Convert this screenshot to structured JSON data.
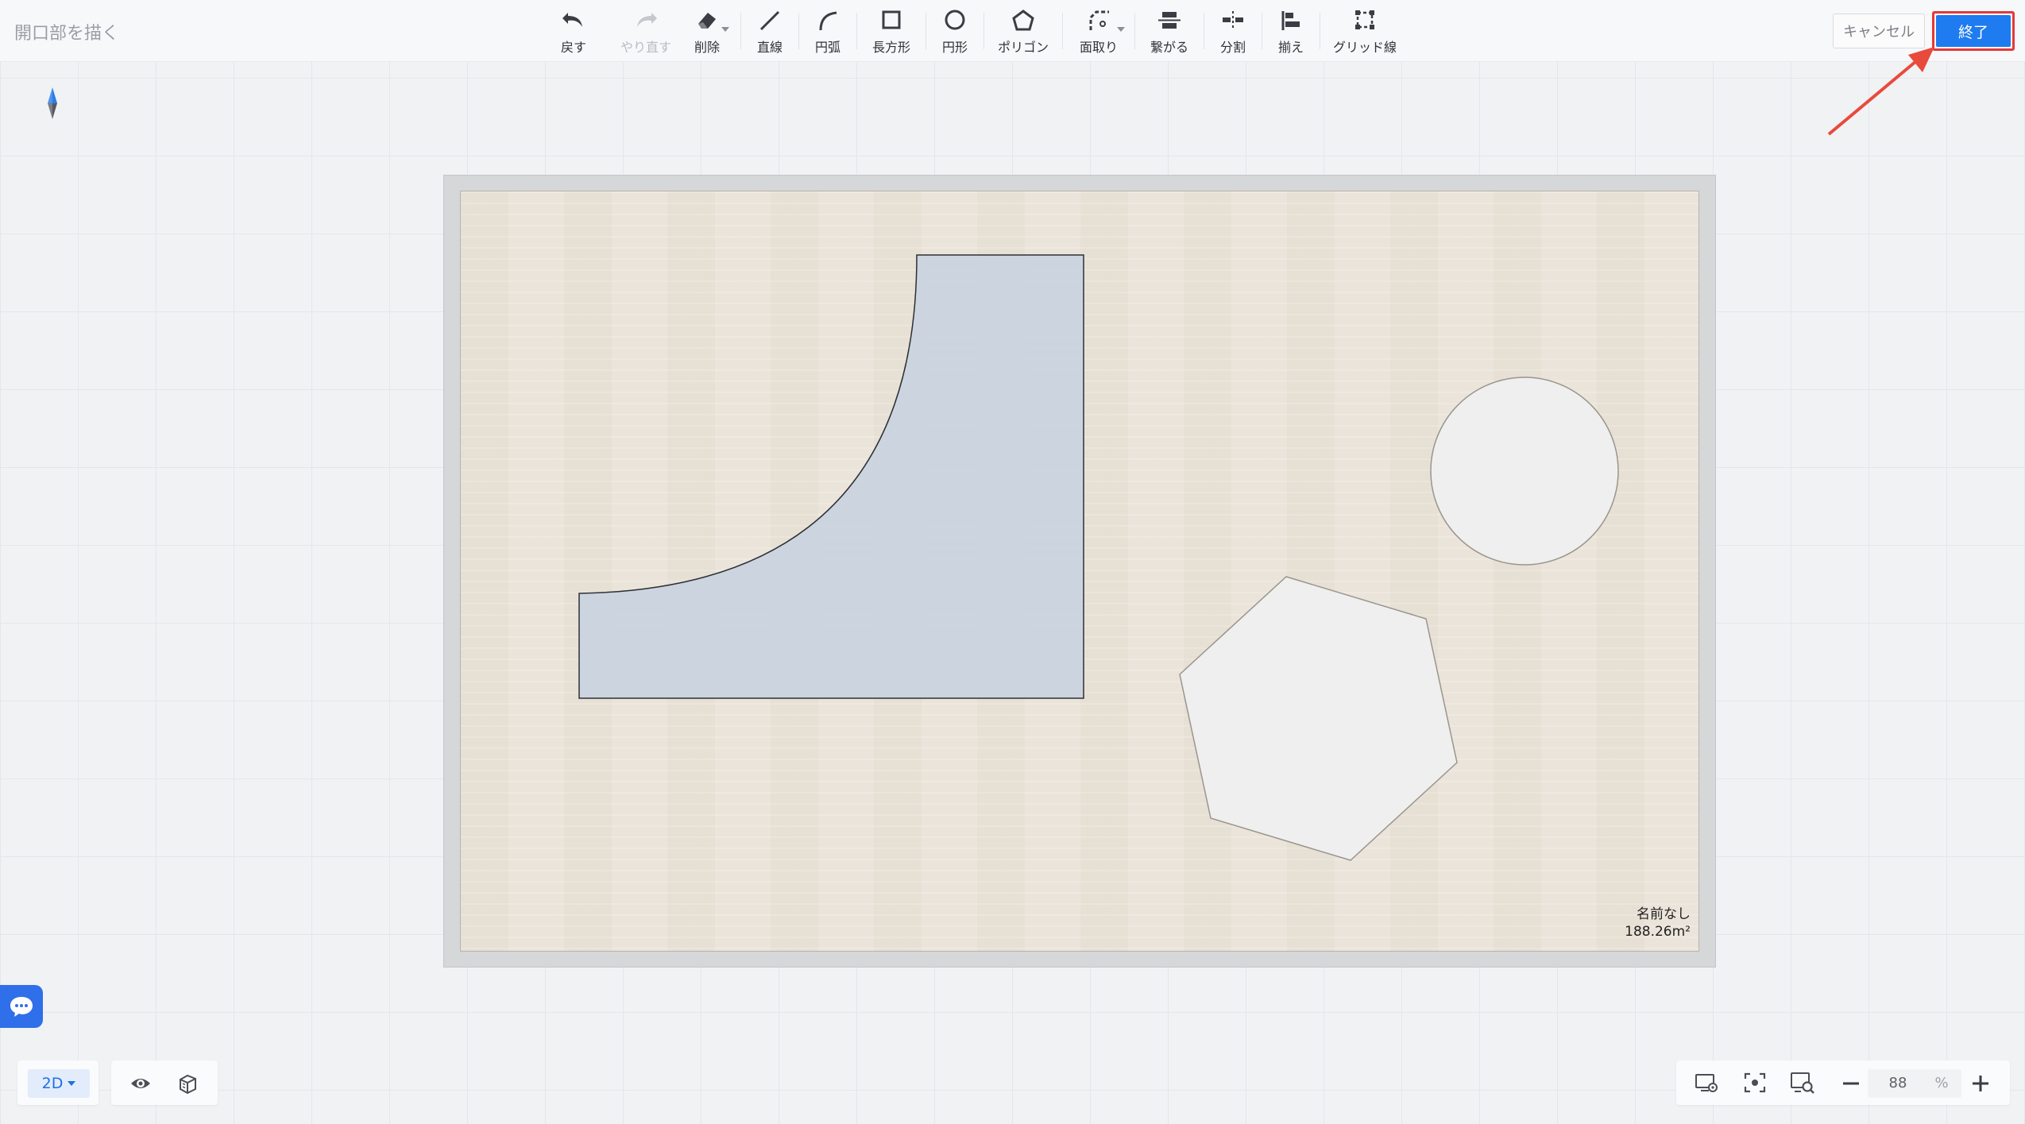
{
  "header": {
    "title": "開口部を描く",
    "cancel_label": "キャンセル",
    "finish_label": "終了"
  },
  "toolbar": {
    "items": [
      {
        "label": "戻す",
        "icon": "undo-icon",
        "enabled": true
      },
      {
        "label": "やり直す",
        "icon": "redo-icon",
        "enabled": false
      },
      {
        "label": "削除",
        "icon": "eraser-icon",
        "enabled": true,
        "dropdown": true
      },
      {
        "label": "直線",
        "icon": "line-icon",
        "enabled": true
      },
      {
        "label": "円弧",
        "icon": "arc-icon",
        "enabled": true
      },
      {
        "label": "長方形",
        "icon": "rectangle-icon",
        "enabled": true
      },
      {
        "label": "円形",
        "icon": "circle-icon",
        "enabled": true
      },
      {
        "label": "ポリゴン",
        "icon": "polygon-icon",
        "enabled": true
      },
      {
        "label": "面取り",
        "icon": "chamfer-icon",
        "enabled": true,
        "dropdown": true
      },
      {
        "label": "繋がる",
        "icon": "connect-icon",
        "enabled": true
      },
      {
        "label": "分割",
        "icon": "split-icon",
        "enabled": true
      },
      {
        "label": "揃え",
        "icon": "align-icon",
        "enabled": true
      },
      {
        "label": "グリッド線",
        "icon": "grid-line-icon",
        "enabled": true
      }
    ]
  },
  "plan": {
    "room_name": "名前なし",
    "room_area": "188.26m²"
  },
  "view": {
    "mode": "2D",
    "zoom": "88",
    "zoom_unit": "%"
  },
  "colors": {
    "accent": "#1e7bf0",
    "highlight_outline": "#e5383b",
    "selected_shape_fill": "#c9d3df",
    "opening_fill": "#efefef",
    "floor": "#ebe4da"
  }
}
